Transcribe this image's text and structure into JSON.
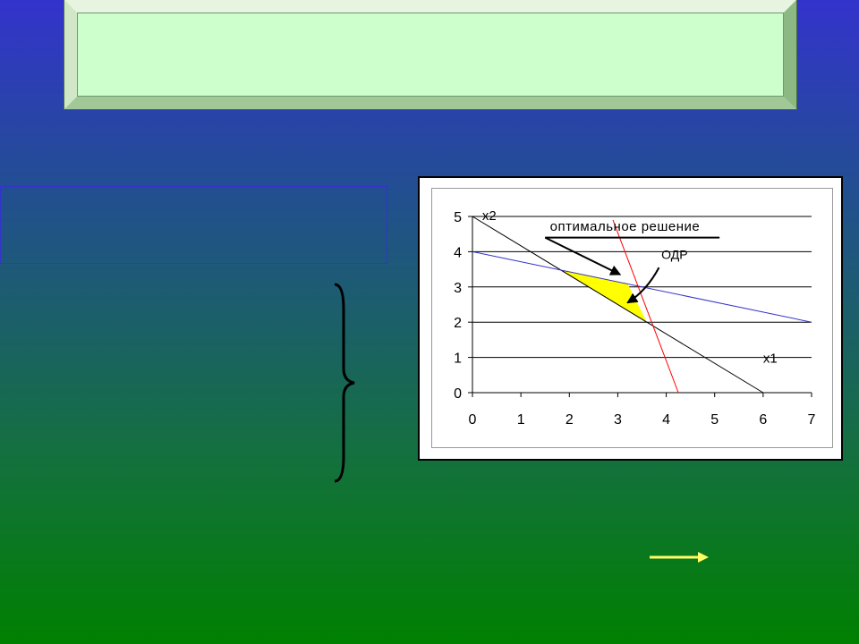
{
  "colors": {
    "title_fill": "#ccffcc",
    "feasible_region": "#ffff00",
    "line_blue": "#3333cc",
    "line_red": "#ff0000",
    "line_black": "#000000",
    "arrow_yellow": "#ffff66"
  },
  "chart_data": {
    "type": "line",
    "xlim": [
      0,
      7
    ],
    "ylim": [
      0,
      5
    ],
    "x_ticks": [
      0,
      1,
      2,
      3,
      4,
      5,
      6,
      7
    ],
    "y_ticks": [
      0,
      1,
      2,
      3,
      4,
      5
    ],
    "grid": "horizontal",
    "legend": "none",
    "series": [
      {
        "color": "#000000",
        "points": [
          [
            0,
            5
          ],
          [
            6,
            0
          ]
        ]
      },
      {
        "color": "#3333cc",
        "points": [
          [
            0,
            4
          ],
          [
            7,
            2
          ]
        ]
      },
      {
        "color": "#ff0000",
        "points": [
          [
            2.9,
            4.9
          ],
          [
            4.25,
            0
          ]
        ]
      }
    ],
    "feasible_region": [
      [
        1.8,
        3.5
      ],
      [
        3.2,
        3.1
      ],
      [
        3.6,
        2.0
      ]
    ],
    "annotations": [
      {
        "id": "x2",
        "text": "x2",
        "x": 0.2,
        "y": 5.0
      },
      {
        "id": "x1",
        "text": "x1",
        "x": 6.0,
        "y": 0.85
      },
      {
        "id": "optimal",
        "text": "оптимальное решение",
        "x": 1.6,
        "y": 4.6
      },
      {
        "id": "odr",
        "text": "ОДР",
        "x": 3.9,
        "y": 3.8
      }
    ]
  }
}
